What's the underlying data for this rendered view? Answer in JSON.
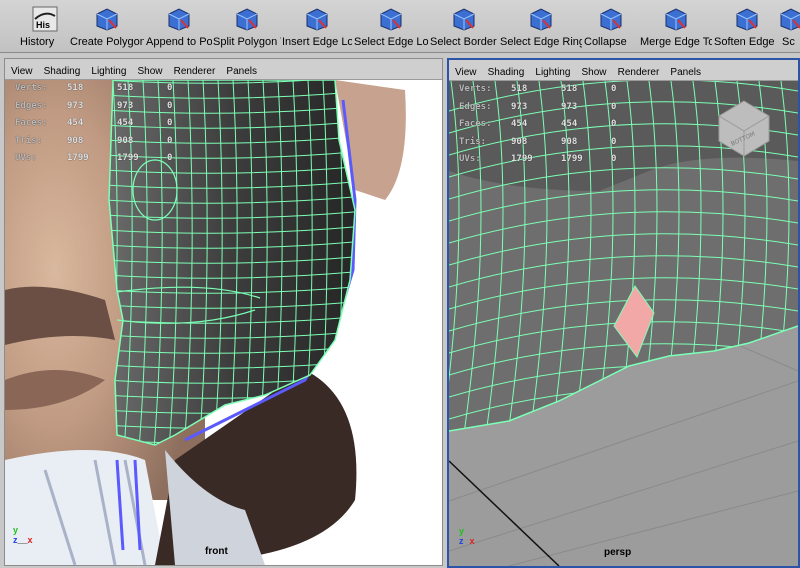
{
  "shelf": {
    "items": [
      {
        "label": "History",
        "icon": "history-icon",
        "icon_text": "His"
      },
      {
        "label": "Create Polygon Tool",
        "icon": "create-polygon-icon"
      },
      {
        "label": "Append to Polygon Tool",
        "icon": "append-polygon-icon"
      },
      {
        "label": "Split Polygon Tool",
        "icon": "split-polygon-icon"
      },
      {
        "label": "Insert Edge Loop Tool",
        "icon": "insert-edge-loop-icon"
      },
      {
        "label": "Select Edge Loop",
        "icon": "select-edge-loop-icon"
      },
      {
        "label": "Select Border Edge",
        "icon": "select-border-edge-icon"
      },
      {
        "label": "Select Edge Ring",
        "icon": "select-edge-ring-icon"
      },
      {
        "label": "Collapse",
        "icon": "collapse-icon"
      },
      {
        "label": "Merge Edge Tool",
        "icon": "merge-edge-icon"
      },
      {
        "label": "Soften Edge",
        "icon": "soften-edge-icon"
      },
      {
        "label": "Sc",
        "icon": "scale-icon"
      }
    ]
  },
  "panel_menu": [
    "View",
    "Shading",
    "Lighting",
    "Show",
    "Renderer",
    "Panels"
  ],
  "stats": {
    "front": [
      {
        "label": "Verts:",
        "a": "518",
        "b": "518",
        "c": "0"
      },
      {
        "label": "Edges:",
        "a": "973",
        "b": "973",
        "c": "0"
      },
      {
        "label": "Faces:",
        "a": "454",
        "b": "454",
        "c": "0"
      },
      {
        "label": "Tris:",
        "a": "908",
        "b": "908",
        "c": "0"
      },
      {
        "label": "UVs:",
        "a": "1799",
        "b": "1799",
        "c": "0"
      }
    ],
    "persp": [
      {
        "label": "Verts:",
        "a": "518",
        "b": "518",
        "c": "0"
      },
      {
        "label": "Edges:",
        "a": "973",
        "b": "973",
        "c": "0"
      },
      {
        "label": "Faces:",
        "a": "454",
        "b": "454",
        "c": "0"
      },
      {
        "label": "Tris:",
        "a": "908",
        "b": "908",
        "c": "0"
      },
      {
        "label": "UVs:",
        "a": "1799",
        "b": "1799",
        "c": "0"
      }
    ]
  },
  "viewports": {
    "front": {
      "camera": "front"
    },
    "persp": {
      "camera": "persp",
      "viewcube_face": "BOTTOM"
    }
  },
  "axes": {
    "y": "y",
    "z": "z",
    "x": "x"
  },
  "colors": {
    "wireframe": "#7dffb5",
    "selected_face": "#f3a8a8",
    "active_panel_border": "#2b54a8",
    "axis_x": "#e02020",
    "axis_y": "#20c020",
    "axis_z": "#2040e0"
  }
}
